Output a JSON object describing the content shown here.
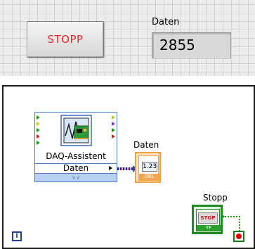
{
  "front_panel": {
    "stop_button_label": "STOPP",
    "indicator_label": "Daten",
    "indicator_value": "2855"
  },
  "block_diagram": {
    "daq_assistant": {
      "title": "DAQ-Assistent",
      "output_label": "Daten",
      "expand_glyph": "∨∨"
    },
    "daten_terminal": {
      "label": "Daten",
      "display_text": "1.23",
      "type_tag": "DBL"
    },
    "stop_terminal": {
      "label": "Stopp",
      "sign_text": "STOP",
      "type_tag": "TF"
    },
    "iteration_terminal": "i"
  },
  "colors": {
    "stop_text": "#e8262a",
    "wire_blue": "#0c2a8a",
    "wire_pink": "#ff9fd4",
    "dbl_orange": "#f0a040",
    "bool_green": "#1f8a1f",
    "loop_red": "#e00000",
    "daq_blue": "#4a80c8"
  }
}
